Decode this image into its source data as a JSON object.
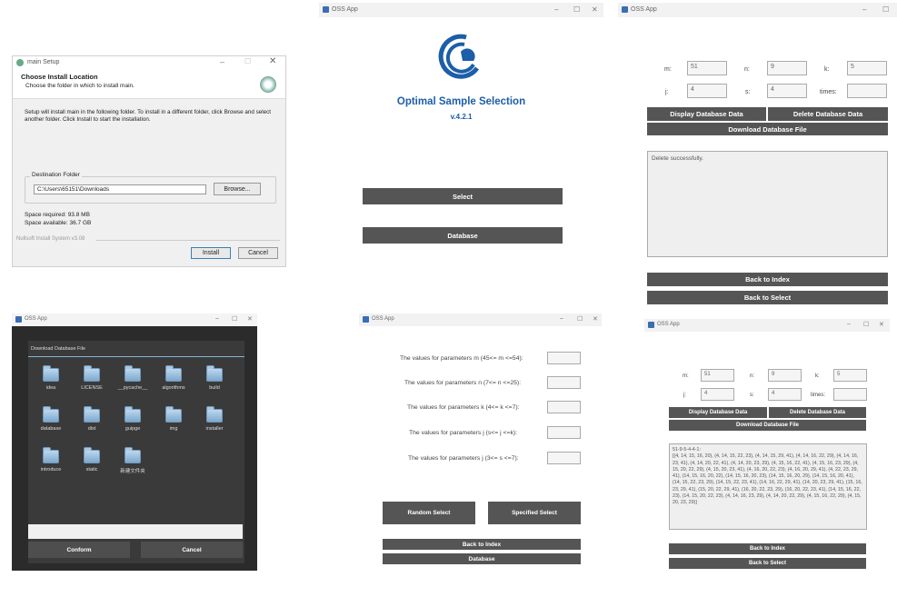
{
  "installer": {
    "title": "main Setup",
    "heading": "Choose Install Location",
    "subheading": "Choose the folder in which to install main.",
    "body": "Setup will install main in the following folder. To install in a different folder, click Browse and select another folder. Click Install to start the installation.",
    "dest_label": "Destination Folder",
    "path": "C:\\Users\\65151\\Downloads",
    "browse": "Browse...",
    "space_required": "Space required: 93.8 MB",
    "space_available": "Space available: 36.7 GB",
    "brand": "Nullsoft Install System v3.08",
    "install": "Install",
    "cancel": "Cancel"
  },
  "win_title": "OSS App",
  "home": {
    "title": "Optimal Sample Selection",
    "version": "v.4.2.1",
    "select": "Select",
    "database": "Database",
    "logo_color": "#1c5ea8"
  },
  "db1": {
    "labels": {
      "m": "m:",
      "n": "n:",
      "k": "k:",
      "j": "j:",
      "s": "s:",
      "times": "times:"
    },
    "values": {
      "m": "51",
      "n": "9",
      "k": "5",
      "j": "4",
      "s": "4",
      "times": ""
    },
    "display": "Display Database Data",
    "delete": "Delete Database Data",
    "download": "Download Database File",
    "output": "Delete successfully.",
    "back_index": "Back to Index",
    "back_select": "Back to Select"
  },
  "filedlg": {
    "header": "Download Database File",
    "folders": [
      "idea",
      "LICENSE",
      "__pycache__",
      "algorithms",
      "build",
      "database",
      "dist",
      "guipge",
      "img",
      "installer",
      "introduce",
      "static",
      "新建文件夹"
    ],
    "conform": "Conform",
    "cancel": "Cancel"
  },
  "select": {
    "params": [
      "The values for parameters m (45<= m <=54):",
      "The values for parameters n (7<= n <=25):",
      "The values for parameters k (4<= k <=7):",
      "The values for parameters j (s<= j <=k):",
      "The values for parameters j (3<= s <=7):"
    ],
    "random": "Random Select",
    "specified": "Specified Select",
    "back_index": "Back to Index",
    "database": "Database"
  },
  "db2": {
    "labels": {
      "m": "m:",
      "n": "n:",
      "k": "k:",
      "j": "j:",
      "s": "s:",
      "times": "times:"
    },
    "values": {
      "m": "51",
      "n": "9",
      "k": "5",
      "j": "4",
      "s": "4",
      "times": ""
    },
    "display": "Display Database Data",
    "delete": "Delete Database Data",
    "download": "Download Database File",
    "output": "51-9-5-4-4-1:\n[(4, 14, 15, 16, 20), (4, 14, 15, 22, 23), (4, 14, 15, 29, 41), (4, 14, 16, 22, 29), (4, 14, 16, 23, 41), (4, 14, 20, 22, 41), (4, 14, 20, 23, 29), (4, 15, 16, 22, 41), (4, 15, 16, 23, 29), (4, 15, 20, 22, 29), (4, 15, 20, 23, 41), (4, 16, 20, 22, 23), (4, 16, 20, 29, 41), (4, 22, 23, 29, 41), (14, 15, 16, 20, 22), (14, 15, 16, 20, 23), (14, 15, 16, 20, 29), (14, 15, 16, 20, 41), (14, 15, 22, 23, 29), (14, 15, 22, 23, 41), (14, 16, 22, 29, 41), (14, 20, 23, 29, 41), (15, 16, 23, 29, 41), (15, 20, 22, 29, 41), (16, 20, 22, 23, 29), (16, 20, 22, 23, 41), (14, 15, 16, 22, 23), (14, 15, 20, 22, 23), (4, 14, 16, 23, 29), (4, 14, 20, 22, 29), (4, 15, 16, 22, 29), (4, 15, 20, 23, 29)]",
    "back_index": "Back to Index",
    "back_select": "Back to Select"
  }
}
